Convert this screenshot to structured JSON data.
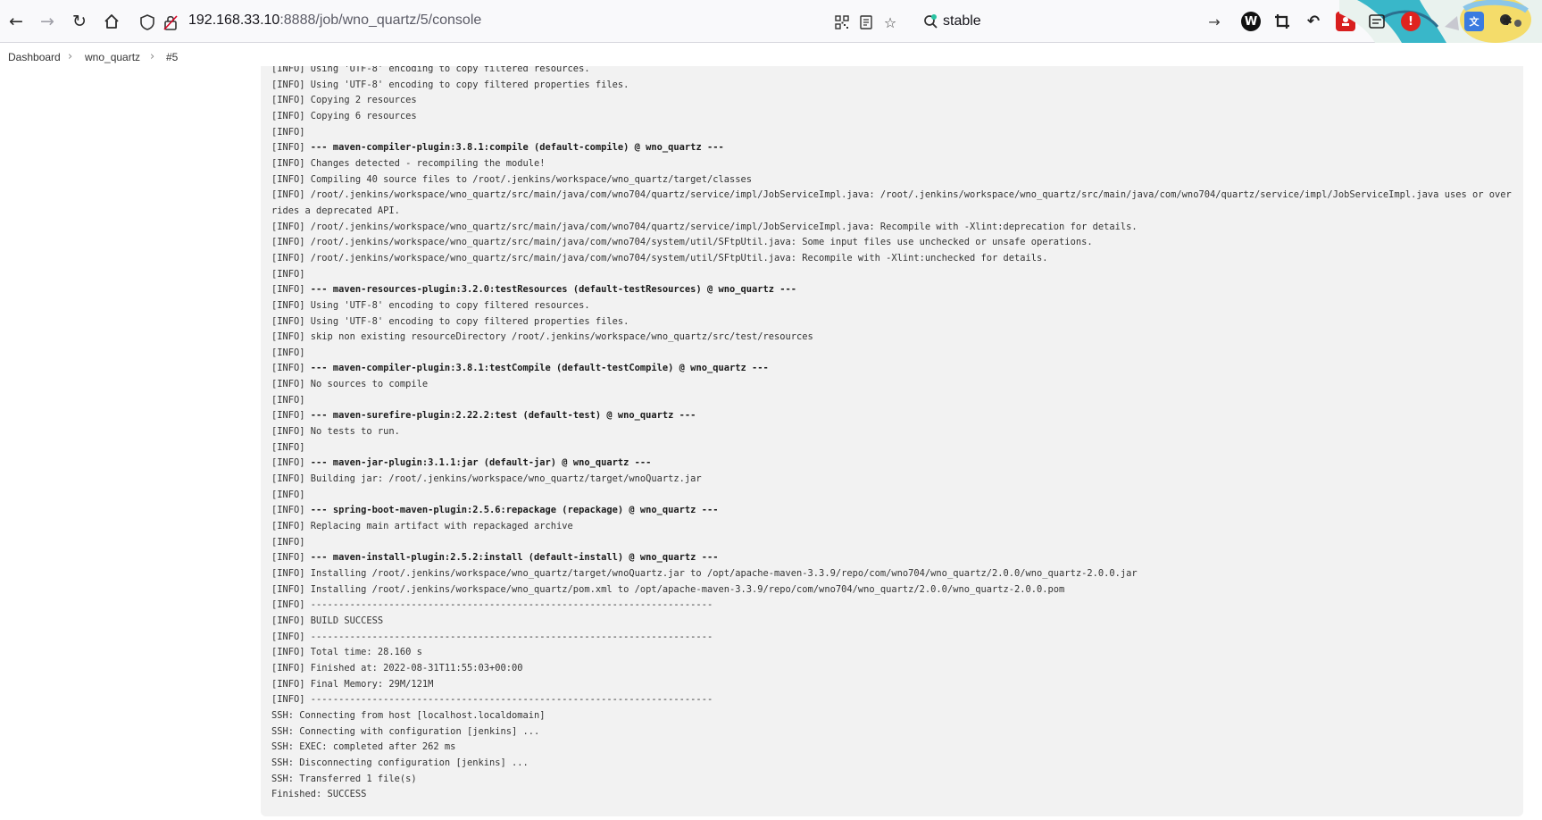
{
  "browser": {
    "url_host": "192.168.33.10",
    "url_path": ":8888/job/wno_quartz/5/console",
    "search_text": "stable",
    "icons": {
      "back": "back-arrow-icon",
      "forward": "forward-arrow-icon",
      "reload": "reload-icon",
      "home": "home-icon",
      "shield": "tracking-shield-icon",
      "lock": "insecure-lock-icon",
      "qr": "qr-code-icon",
      "reader": "reader-view-icon",
      "bookmark": "bookmark-star-icon",
      "search": "search-icon",
      "go": "go-arrow-icon"
    }
  },
  "breadcrumb": {
    "items": [
      "Dashboard",
      "wno_quartz",
      "#5"
    ]
  },
  "console": {
    "lines": [
      {
        "t": "[INFO] Using 'UTF-8' encoding to copy filtered resources."
      },
      {
        "t": "[INFO] Using 'UTF-8' encoding to copy filtered properties files."
      },
      {
        "t": "[INFO] Copying 2 resources"
      },
      {
        "t": "[INFO] Copying 6 resources"
      },
      {
        "t": "[INFO]"
      },
      {
        "t": "[INFO] ",
        "b": "--- maven-compiler-plugin:3.8.1:compile (default-compile) @ wno_quartz ---"
      },
      {
        "t": "[INFO] Changes detected - recompiling the module!"
      },
      {
        "t": "[INFO] Compiling 40 source files to /root/.jenkins/workspace/wno_quartz/target/classes"
      },
      {
        "t": "[INFO] /root/.jenkins/workspace/wno_quartz/src/main/java/com/wno704/quartz/service/impl/JobServiceImpl.java: /root/.jenkins/workspace/wno_quartz/src/main/java/com/wno704/quartz/service/impl/JobServiceImpl.java uses or overrides a deprecated API."
      },
      {
        "t": "[INFO] /root/.jenkins/workspace/wno_quartz/src/main/java/com/wno704/quartz/service/impl/JobServiceImpl.java: Recompile with -Xlint:deprecation for details."
      },
      {
        "t": "[INFO] /root/.jenkins/workspace/wno_quartz/src/main/java/com/wno704/system/util/SFtpUtil.java: Some input files use unchecked or unsafe operations."
      },
      {
        "t": "[INFO] /root/.jenkins/workspace/wno_quartz/src/main/java/com/wno704/system/util/SFtpUtil.java: Recompile with -Xlint:unchecked for details."
      },
      {
        "t": "[INFO]"
      },
      {
        "t": "[INFO] ",
        "b": "--- maven-resources-plugin:3.2.0:testResources (default-testResources) @ wno_quartz ---"
      },
      {
        "t": "[INFO] Using 'UTF-8' encoding to copy filtered resources."
      },
      {
        "t": "[INFO] Using 'UTF-8' encoding to copy filtered properties files."
      },
      {
        "t": "[INFO] skip non existing resourceDirectory /root/.jenkins/workspace/wno_quartz/src/test/resources"
      },
      {
        "t": "[INFO]"
      },
      {
        "t": "[INFO] ",
        "b": "--- maven-compiler-plugin:3.8.1:testCompile (default-testCompile) @ wno_quartz ---"
      },
      {
        "t": "[INFO] No sources to compile"
      },
      {
        "t": "[INFO]"
      },
      {
        "t": "[INFO] ",
        "b": "--- maven-surefire-plugin:2.22.2:test (default-test) @ wno_quartz ---"
      },
      {
        "t": "[INFO] No tests to run."
      },
      {
        "t": "[INFO]"
      },
      {
        "t": "[INFO] ",
        "b": "--- maven-jar-plugin:3.1.1:jar (default-jar) @ wno_quartz ---"
      },
      {
        "t": "[INFO] Building jar: /root/.jenkins/workspace/wno_quartz/target/wnoQuartz.jar"
      },
      {
        "t": "[INFO]"
      },
      {
        "t": "[INFO] ",
        "b": "--- spring-boot-maven-plugin:2.5.6:repackage (repackage) @ wno_quartz ---"
      },
      {
        "t": "[INFO] Replacing main artifact with repackaged archive"
      },
      {
        "t": "[INFO]"
      },
      {
        "t": "[INFO] ",
        "b": "--- maven-install-plugin:2.5.2:install (default-install) @ wno_quartz ---"
      },
      {
        "t": "[INFO] Installing /root/.jenkins/workspace/wno_quartz/target/wnoQuartz.jar to /opt/apache-maven-3.3.9/repo/com/wno704/wno_quartz/2.0.0/wno_quartz-2.0.0.jar"
      },
      {
        "t": "[INFO] Installing /root/.jenkins/workspace/wno_quartz/pom.xml to /opt/apache-maven-3.3.9/repo/com/wno704/wno_quartz/2.0.0/wno_quartz-2.0.0.pom"
      },
      {
        "t": "[INFO] ------------------------------------------------------------------------"
      },
      {
        "t": "[INFO] BUILD SUCCESS"
      },
      {
        "t": "[INFO] ------------------------------------------------------------------------"
      },
      {
        "t": "[INFO] Total time: 28.160 s"
      },
      {
        "t": "[INFO] Finished at: 2022-08-31T11:55:03+00:00"
      },
      {
        "t": "[INFO] Final Memory: 29M/121M"
      },
      {
        "t": "[INFO] ------------------------------------------------------------------------"
      },
      {
        "t": "SSH: Connecting from host [localhost.localdomain]"
      },
      {
        "t": "SSH: Connecting with configuration [jenkins] ..."
      },
      {
        "t": "SSH: EXEC: completed after 262 ms"
      },
      {
        "t": "SSH: Disconnecting configuration [jenkins] ..."
      },
      {
        "t": "SSH: Transferred 1 file(s)"
      },
      {
        "t": "Finished: SUCCESS"
      }
    ]
  }
}
